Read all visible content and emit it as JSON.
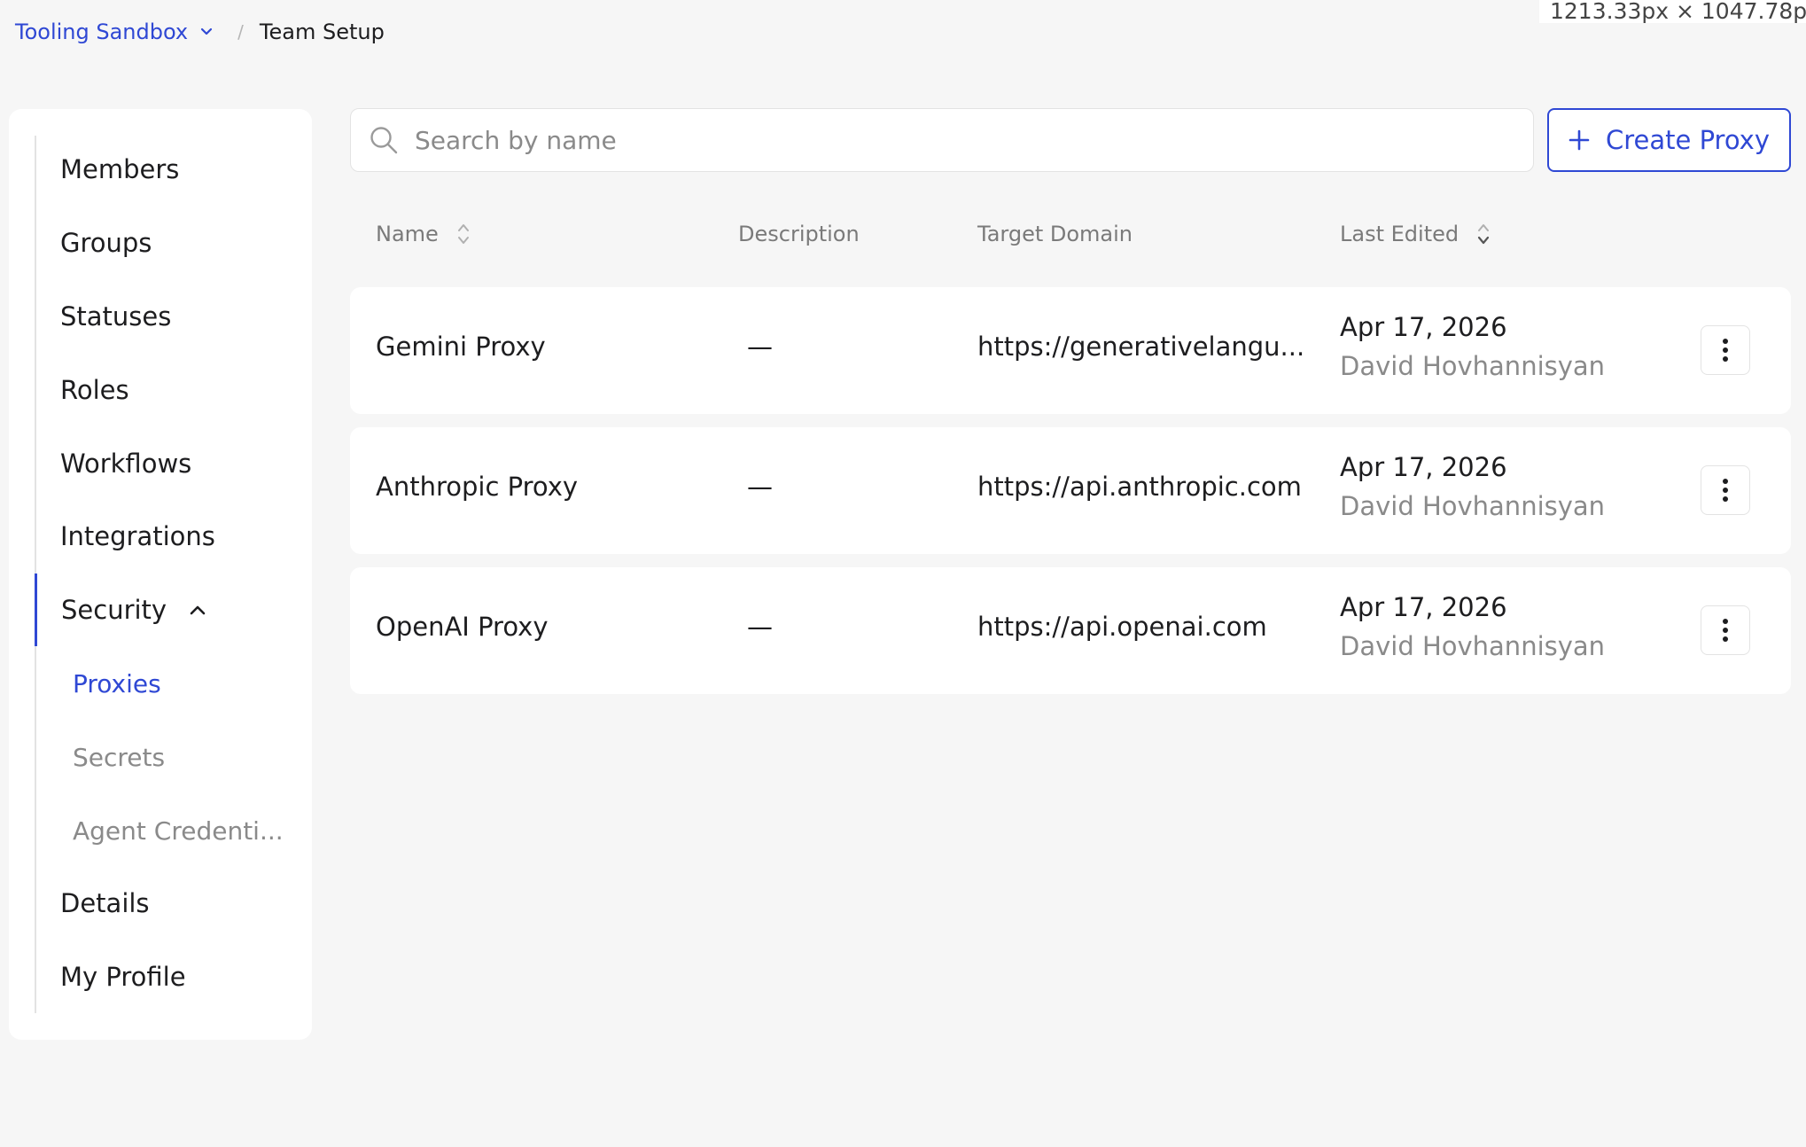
{
  "overlay": {
    "dimensions_text": "1213.33px × 1047.78px"
  },
  "breadcrumb": {
    "org": "Tooling Sandbox",
    "separator": "/",
    "current": "Team Setup"
  },
  "sidebar": {
    "items": [
      {
        "label": "Members"
      },
      {
        "label": "Groups"
      },
      {
        "label": "Statuses"
      },
      {
        "label": "Roles"
      },
      {
        "label": "Workflows"
      },
      {
        "label": "Integrations"
      },
      {
        "label": "Security",
        "expanded": true
      },
      {
        "label": "Details"
      },
      {
        "label": "My Profile"
      }
    ],
    "security_children": [
      {
        "label": "Proxies",
        "selected": true
      },
      {
        "label": "Secrets"
      },
      {
        "label": "Agent Credenti..."
      }
    ]
  },
  "search": {
    "placeholder": "Search by name",
    "value": ""
  },
  "toolbar": {
    "create_label": "Create Proxy"
  },
  "table": {
    "columns": [
      "Name",
      "Description",
      "Target Domain",
      "Last Edited"
    ],
    "rows": [
      {
        "name": "Gemini Proxy",
        "description": "—",
        "target_domain": "https://generativelangu...",
        "date": "Apr 17, 2026",
        "editor": "David Hovhannisyan"
      },
      {
        "name": "Anthropic Proxy",
        "description": "—",
        "target_domain": "https://api.anthropic.com",
        "date": "Apr 17, 2026",
        "editor": "David Hovhannisyan"
      },
      {
        "name": "OpenAI Proxy",
        "description": "—",
        "target_domain": "https://api.openai.com",
        "date": "Apr 17, 2026",
        "editor": "David Hovhannisyan"
      }
    ]
  },
  "colors": {
    "accent": "#2f48d4",
    "muted_text": "#8a8a8a",
    "background": "#f6f6f6"
  },
  "icons": {
    "search": "search-icon",
    "create": "plus-icon",
    "row_menu": "kebab-icon",
    "sort": "sort-icon",
    "org_caret": "chevron-down-icon",
    "section_caret": "chevron-up-icon"
  }
}
